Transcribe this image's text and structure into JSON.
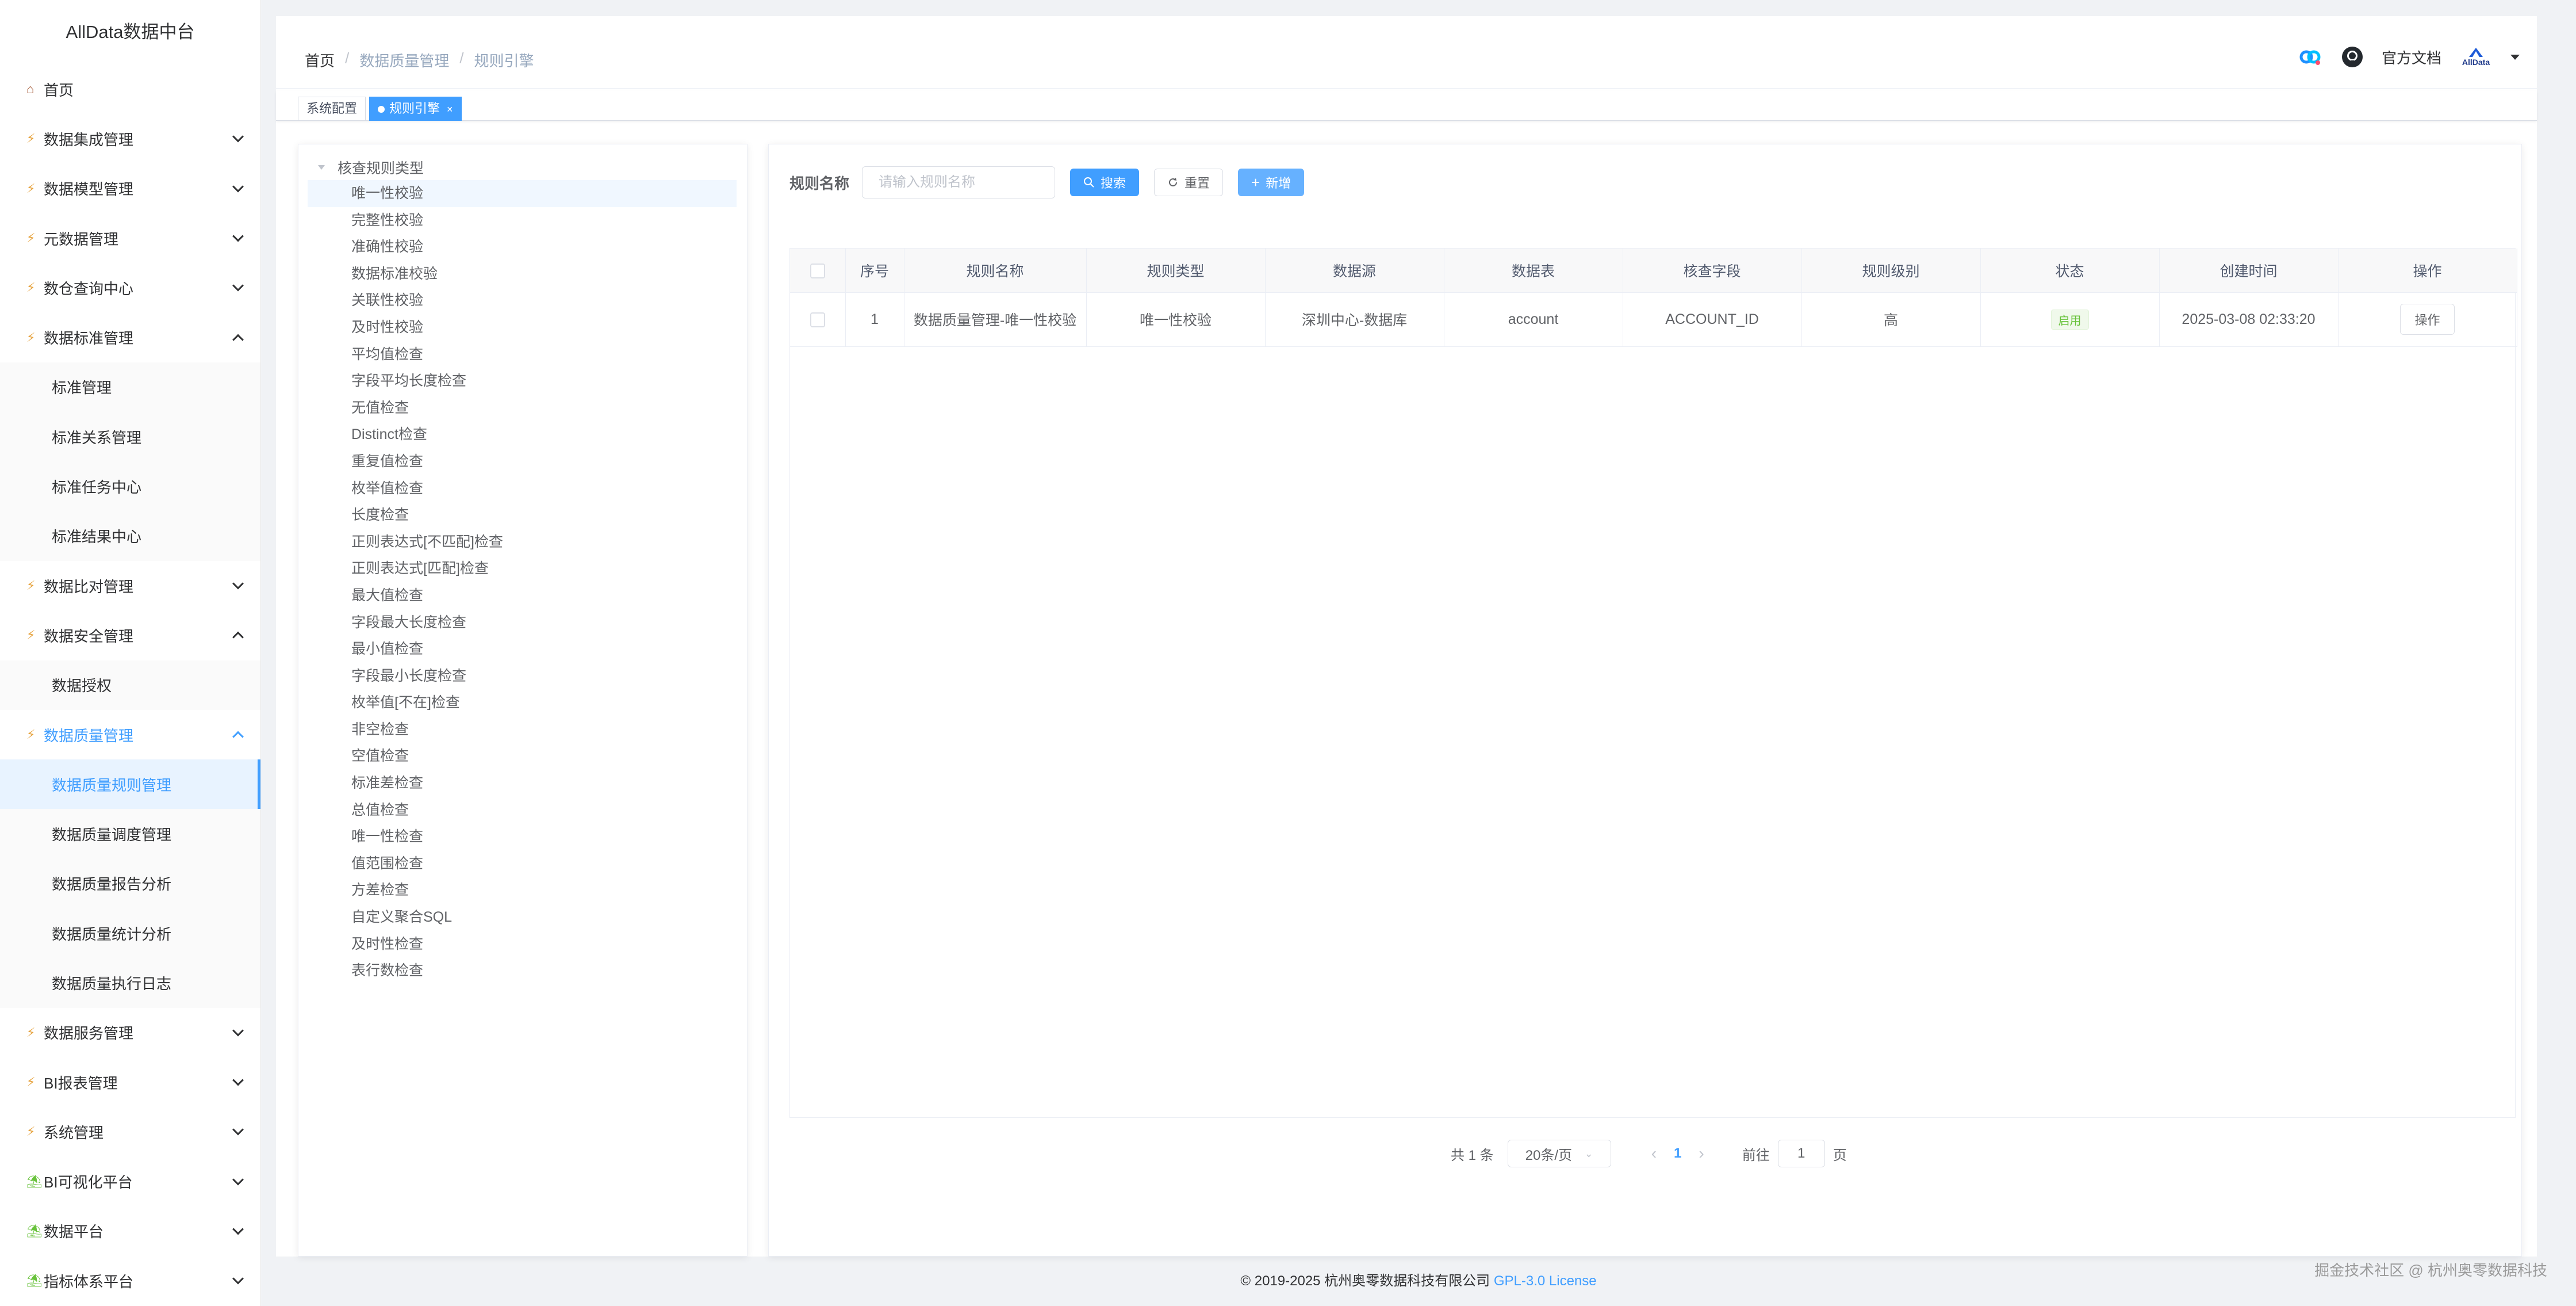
{
  "app": {
    "title": "AllData数据中台"
  },
  "sidebar": {
    "items": [
      {
        "label": "首页",
        "icon": "home-icon",
        "type": "home"
      },
      {
        "label": "数据集成管理",
        "icon": "bolt-icon",
        "chevron": "down"
      },
      {
        "label": "数据模型管理",
        "icon": "bolt-icon",
        "chevron": "down"
      },
      {
        "label": "元数据管理",
        "icon": "bolt-icon",
        "chevron": "down"
      },
      {
        "label": "数仓查询中心",
        "icon": "bolt-icon",
        "chevron": "down"
      },
      {
        "label": "数据标准管理",
        "icon": "bolt-icon",
        "chevron": "up"
      },
      {
        "label": "标准管理",
        "sub": true
      },
      {
        "label": "标准关系管理",
        "sub": true
      },
      {
        "label": "标准任务中心",
        "sub": true
      },
      {
        "label": "标准结果中心",
        "sub": true
      },
      {
        "label": "数据比对管理",
        "icon": "bolt-icon",
        "chevron": "down"
      },
      {
        "label": "数据安全管理",
        "icon": "bolt-icon",
        "chevron": "up"
      },
      {
        "label": "数据授权",
        "sub": true
      },
      {
        "label": "数据质量管理",
        "icon": "bolt-icon",
        "chevron": "up",
        "active_parent": true
      },
      {
        "label": "数据质量规则管理",
        "sub": true,
        "active": true
      },
      {
        "label": "数据质量调度管理",
        "sub": true
      },
      {
        "label": "数据质量报告分析",
        "sub": true
      },
      {
        "label": "数据质量统计分析",
        "sub": true
      },
      {
        "label": "数据质量执行日志",
        "sub": true
      },
      {
        "label": "数据服务管理",
        "icon": "bolt-icon",
        "chevron": "down"
      },
      {
        "label": "BI报表管理",
        "icon": "bolt-icon",
        "chevron": "down"
      },
      {
        "label": "系统管理",
        "icon": "bolt-icon",
        "chevron": "down"
      },
      {
        "label": "BI可视化平台",
        "icon": "platform-icon",
        "chevron": "down",
        "type": "plat"
      },
      {
        "label": "数据平台",
        "icon": "platform-icon",
        "chevron": "down",
        "type": "plat"
      },
      {
        "label": "指标体系平台",
        "icon": "platform-icon",
        "chevron": "down",
        "type": "plat"
      }
    ]
  },
  "header": {
    "breadcrumb": [
      "首页",
      "数据质量管理",
      "规则引擎"
    ],
    "docs_label": "官方文档",
    "avatar_text": "AllData"
  },
  "tags": [
    {
      "label": "系统配置",
      "active": false
    },
    {
      "label": "规则引擎",
      "active": true,
      "close": "×"
    }
  ],
  "tree": {
    "root": "核查规则类型",
    "nodes": [
      "唯一性校验",
      "完整性校验",
      "准确性校验",
      "数据标准校验",
      "关联性校验",
      "及时性校验",
      "平均值检查",
      "字段平均长度检查",
      "无值检查",
      "Distinct检查",
      "重复值检查",
      "枚举值检查",
      "长度检查",
      "正则表达式[不匹配]检查",
      "正则表达式[匹配]检查",
      "最大值检查",
      "字段最大长度检查",
      "最小值检查",
      "字段最小长度检查",
      "枚举值[不在]检查",
      "非空检查",
      "空值检查",
      "标准差检查",
      "总值检查",
      "唯一性检查",
      "值范围检查",
      "方差检查",
      "自定义聚合SQL",
      "及时性检查",
      "表行数检查"
    ],
    "selected_index": 0
  },
  "search": {
    "label": "规则名称",
    "placeholder": "请输入规则名称",
    "search_btn": "搜索",
    "reset_btn": "重置",
    "add_btn": "新增"
  },
  "table": {
    "columns": [
      "序号",
      "规则名称",
      "规则类型",
      "数据源",
      "数据表",
      "核查字段",
      "规则级别",
      "状态",
      "创建时间",
      "操作"
    ],
    "rows": [
      {
        "index": "1",
        "name": "数据质量管理-唯一性校验",
        "type": "唯一性校验",
        "source": "深圳中心-数据库",
        "table": "account",
        "field": "ACCOUNT_ID",
        "level": "高",
        "status": "启用",
        "created": "2025-03-08 02:33:20",
        "action": "操作"
      }
    ]
  },
  "pagination": {
    "total": "共 1 条",
    "page_size": "20条/页",
    "current": "1",
    "goto_label": "前往",
    "goto_value": "1",
    "page_unit": "页"
  },
  "footer": {
    "copyright": "© 2019-2025 杭州奥零数据科技有限公司",
    "license": "GPL-3.0 License",
    "watermark": "掘金技术社区 @ 杭州奥零数据科技"
  },
  "colors": {
    "accent": "#409eff",
    "success": "#67c23a"
  }
}
